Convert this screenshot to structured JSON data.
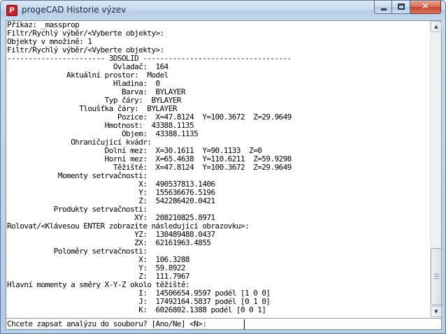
{
  "window": {
    "title": "progeCAD Historie výzev",
    "app_icon_letter": "P",
    "min_glyph": "",
    "max_glyph": "",
    "close_glyph": "✕"
  },
  "output_lines": [
    "Příkaz: _massprop",
    "Filtr/Rychlý výběr/<Vyberte objekty>:",
    "Objekty v množině: 1",
    "Filtr/Rychlý výběr/<Vyberte objekty>:",
    "----------------------- 3DSOLID -----------------------------------",
    "                         Ovladač:  164",
    "              Aktuální prostor:  Model",
    "                         Hladina:  0",
    "                           Barva:  BYLAYER",
    "                       Typ čáry:  BYLAYER",
    "                 Tloušťka čáry:  BYLAYER",
    "                          Pozice:  X=47.8124  Y=100.3672  Z=29.9649",
    "                       Hmotnost:  43388.1135",
    "                           Objem:  43388.1135",
    "               Ohraničující kvádr:",
    "                       Dolní mez:  X=30.1611  Y=90.1133  Z=0",
    "                       Horní mez:  X=65.4638  Y=110.6211  Z=59.9298",
    "                         Těžiště:  X=47.8124  Y=100.3672  Z=29.9649",
    "            Momenty setrvačnosti:",
    "                               X:  490537813.1406",
    "                               Y:  155636676.5196",
    "                               Z:  542286420.0421",
    "           Produkty setrvačnosti:",
    "                              XY:  208210825.8971",
    "Rolovat/<Klávesou ENTER zobrazíte následující obrazovku>:",
    "                              YZ:  130489488.0437",
    "                              ZX:  62161963.4855",
    "           Poloměry setrvačnosti:",
    "                               X:  106.3288",
    "                               Y:  59.8922",
    "                               Z:  111.7967",
    "Hlavní momenty a směry X-Y-Z okolo těžiště:",
    "                               I:  14506654.9597 podél [1 0 0]",
    "                               J:  17492164.5837 podél [0 1 0]",
    "                               K:  6026802.1388 podél [0 0 1]"
  ],
  "command_line": {
    "prompt": "Chcete zapsat analýzu do souboru? [Ano/Ne] <N>:",
    "value": ""
  },
  "scrollbar": {
    "up_glyph": "▲",
    "down_glyph": "▼",
    "position_fraction": 1.0
  }
}
